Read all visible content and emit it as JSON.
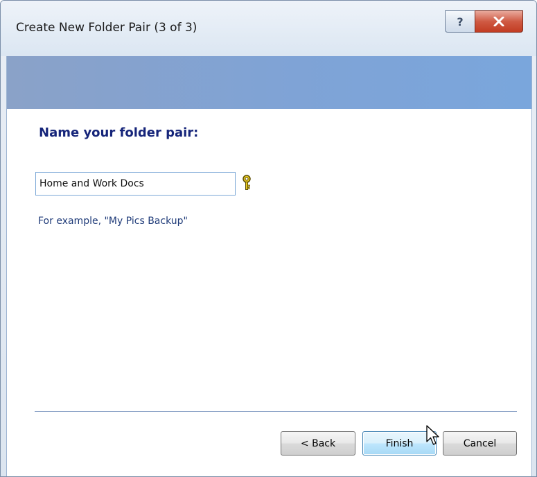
{
  "window": {
    "title": "Create New Folder Pair (3 of 3)",
    "help_glyph": "?",
    "close_glyph": "x"
  },
  "page": {
    "heading": "Name your folder pair:",
    "name_value": "Home and Work Docs",
    "example_text": "For example, \"My Pics Backup\""
  },
  "buttons": {
    "back": "< Back",
    "finish": "Finish",
    "cancel": "Cancel"
  },
  "icons": {
    "help": "help-icon",
    "close": "close-icon",
    "key": "key-icon",
    "cursor": "mouse-cursor"
  },
  "colors": {
    "banner": "#7fa3d6",
    "heading": "#16257a",
    "example": "#1e3a78",
    "close": "#c23c22"
  }
}
